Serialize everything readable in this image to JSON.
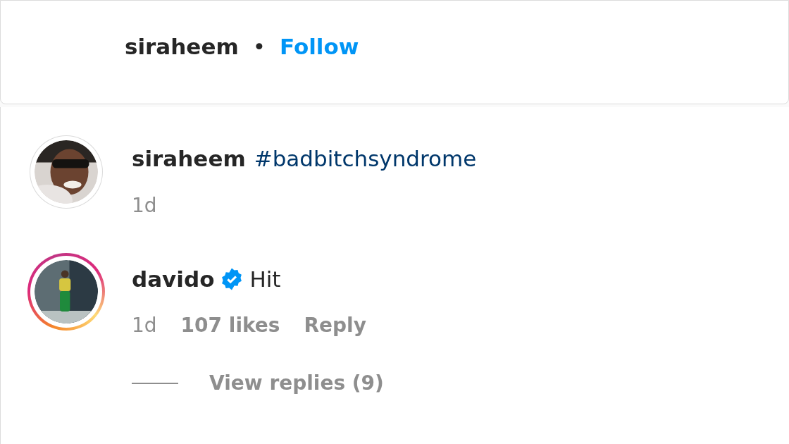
{
  "header": {
    "username": "siraheem",
    "separator": "•",
    "follow": "Follow"
  },
  "comments": [
    {
      "username": "siraheem",
      "verified": false,
      "has_story": false,
      "avatar": {
        "kind": "portrait"
      },
      "body": {
        "kind": "hashtag",
        "text": "#badbitchsyndrome"
      },
      "meta": [
        {
          "kind": "time",
          "text": "1d"
        }
      ]
    },
    {
      "username": "davido",
      "verified": true,
      "has_story": true,
      "avatar": {
        "kind": "fullbody"
      },
      "body": {
        "kind": "plain",
        "text": "Hit"
      },
      "meta": [
        {
          "kind": "time",
          "text": "1d"
        },
        {
          "kind": "likes",
          "text": "107 likes"
        },
        {
          "kind": "action",
          "text": "Reply"
        }
      ],
      "view_replies": "View replies (9)"
    }
  ]
}
